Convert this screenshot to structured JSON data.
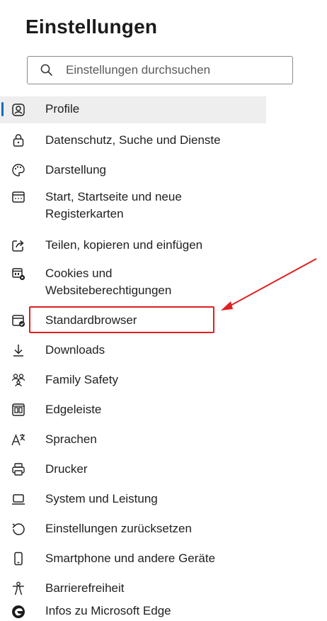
{
  "title": "Einstellungen",
  "search": {
    "placeholder": "Einstellungen durchsuchen",
    "icon": "search-icon"
  },
  "menu": {
    "items": [
      {
        "label": "Profile",
        "icon": "profile-icon",
        "selected": true
      },
      {
        "label": "Datenschutz, Suche und Dienste",
        "icon": "lock-icon"
      },
      {
        "label": "Darstellung",
        "icon": "palette-icon"
      },
      {
        "label": "Start, Startseite und neue\nRegisterkarten",
        "icon": "start-page-icon"
      },
      {
        "label": "Teilen, kopieren und einfügen",
        "icon": "share-icon"
      },
      {
        "label": "Cookies und\nWebsiteberechtigungen",
        "icon": "cookies-icon"
      },
      {
        "label": "Standardbrowser",
        "icon": "default-browser-icon",
        "highlighted": true
      },
      {
        "label": "Downloads",
        "icon": "download-icon"
      },
      {
        "label": "Family Safety",
        "icon": "family-icon"
      },
      {
        "label": "Edgeleiste",
        "icon": "sidebar-icon"
      },
      {
        "label": "Sprachen",
        "icon": "language-icon"
      },
      {
        "label": "Drucker",
        "icon": "printer-icon"
      },
      {
        "label": "System und Leistung",
        "icon": "laptop-icon"
      },
      {
        "label": "Einstellungen zurücksetzen",
        "icon": "reset-icon"
      },
      {
        "label": "Smartphone und andere Geräte",
        "icon": "phone-icon"
      },
      {
        "label": "Barrierefreiheit",
        "icon": "accessibility-icon"
      },
      {
        "label": "Infos zu Microsoft Edge",
        "icon": "edge-logo-icon"
      }
    ]
  },
  "colors": {
    "accent": "#0f6cbd",
    "annotation": "#e02020",
    "selected_bg": "#eeeeee"
  }
}
